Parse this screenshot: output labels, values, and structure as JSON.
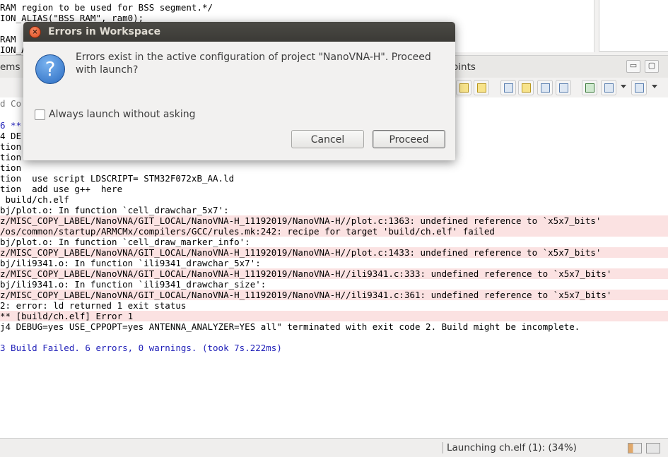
{
  "editor": {
    "lines": [
      "RAM region to be used for BSS segment.*/",
      "ION_ALIAS(\"BSS_RAM\", ram0);",
      "",
      "RAM",
      "ION_A"
    ]
  },
  "tabbar": {
    "left_fragment": "ems",
    "right_fragment": "oints",
    "minimize": "▭",
    "maximize": "▢"
  },
  "console": {
    "lines": [
      {
        "text": "d Co",
        "style": "gray"
      },
      {
        "text": "6 **",
        "style": "blue"
      },
      {
        "text": "4 DE",
        "style": "normal"
      },
      {
        "text": "tion",
        "style": "normal"
      },
      {
        "text": "tion",
        "style": "normal"
      },
      {
        "text": "tion",
        "style": "normal"
      },
      {
        "text": "tion  use script LDSCRIPT= STM32F072xB_AA.ld",
        "style": "normal"
      },
      {
        "text": "tion  add use g++  here",
        "style": "normal"
      },
      {
        "text": " build/ch.elf",
        "style": "normal"
      },
      {
        "text": "bj/plot.o: In function `cell_drawchar_5x7':",
        "style": "normal"
      },
      {
        "text": "z/MISC_COPY_LABEL/NanoVNA/GIT_LOCAL/NanoVNA-H_11192019/NanoVNA-H//plot.c:1363: undefined reference to `x5x7_bits'",
        "style": "err"
      },
      {
        "text": "/os/common/startup/ARMCMx/compilers/GCC/rules.mk:242: recipe for target 'build/ch.elf' failed",
        "style": "err"
      },
      {
        "text": "bj/plot.o: In function `cell_draw_marker_info':",
        "style": "normal"
      },
      {
        "text": "z/MISC_COPY_LABEL/NanoVNA/GIT_LOCAL/NanoVNA-H_11192019/NanoVNA-H//plot.c:1433: undefined reference to `x5x7_bits'",
        "style": "err"
      },
      {
        "text": "bj/ili9341.o: In function `ili9341_drawchar_5x7':",
        "style": "normal"
      },
      {
        "text": "z/MISC_COPY_LABEL/NanoVNA/GIT_LOCAL/NanoVNA-H_11192019/NanoVNA-H//ili9341.c:333: undefined reference to `x5x7_bits'",
        "style": "err"
      },
      {
        "text": "bj/ili9341.o: In function `ili9341_drawchar_size':",
        "style": "normal"
      },
      {
        "text": "z/MISC_COPY_LABEL/NanoVNA/GIT_LOCAL/NanoVNA-H_11192019/NanoVNA-H//ili9341.c:361: undefined reference to `x5x7_bits'",
        "style": "err"
      },
      {
        "text": "2: error: ld returned 1 exit status",
        "style": "normal"
      },
      {
        "text": "** [build/ch.elf] Error 1",
        "style": "err"
      },
      {
        "text": "j4 DEBUG=yes USE_CPPOPT=yes ANTENNA_ANALYZER=YES all\" terminated with exit code 2. Build might be incomplete.",
        "style": "normal"
      },
      {
        "text": "",
        "style": "normal"
      },
      {
        "text": "3 Build Failed. 6 errors, 0 warnings. (took 7s.222ms)",
        "style": "blue"
      }
    ]
  },
  "status": {
    "text": "Launching ch.elf (1): (34%)",
    "progress": 0.34
  },
  "dialog": {
    "title": "Errors in Workspace",
    "close_glyph": "×",
    "question_glyph": "?",
    "message": "Errors exist in the active configuration of project \"NanoVNA-H\". Proceed with launch?",
    "checkbox_label": "Always launch without asking",
    "checkbox_checked": false,
    "cancel_label": "Cancel",
    "proceed_label": "Proceed"
  }
}
